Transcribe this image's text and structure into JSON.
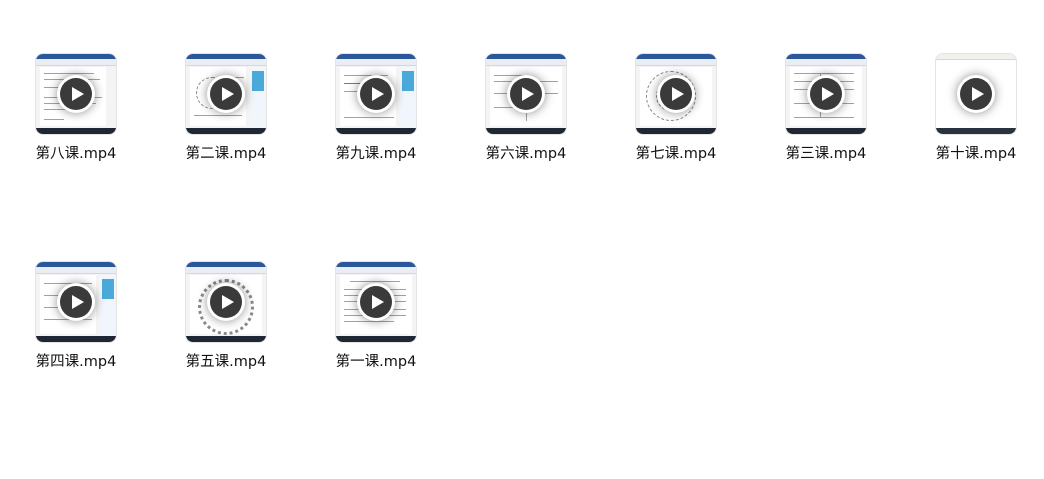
{
  "files": [
    {
      "name": "第八课.mp4"
    },
    {
      "name": "第二课.mp4"
    },
    {
      "name": "第九课.mp4"
    },
    {
      "name": "第六课.mp4"
    },
    {
      "name": "第七课.mp4"
    },
    {
      "name": "第三课.mp4"
    },
    {
      "name": "第十课.mp4"
    },
    {
      "name": "第四课.mp4"
    },
    {
      "name": "第五课.mp4"
    },
    {
      "name": "第一课.mp4"
    }
  ],
  "icons": {
    "play": "play-icon"
  },
  "colors": {
    "word_title_bar": "#2b579a",
    "taskbar": "#1f2733",
    "play_button": "#3a3a3a"
  }
}
